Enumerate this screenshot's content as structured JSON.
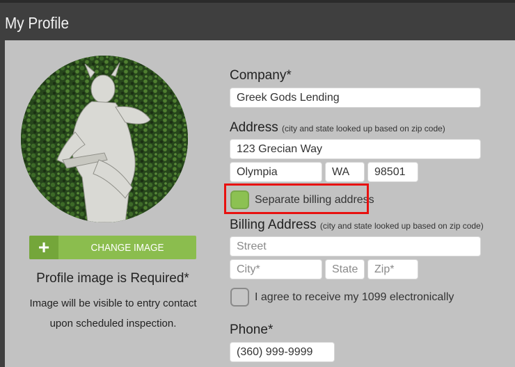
{
  "header": {
    "title": "My Profile"
  },
  "profile_image": {
    "change_button_label": "CHANGE IMAGE",
    "required_text": "Profile image is Required*",
    "visibility_note": "Image will be visible to entry contact upon scheduled inspection."
  },
  "company": {
    "label": "Company*",
    "value": "Greek Gods Lending"
  },
  "address": {
    "label": "Address",
    "hint": "(city and state looked up based on zip code)",
    "street": "123 Grecian Way",
    "city": "Olympia",
    "state": "WA",
    "zip": "98501"
  },
  "separate_billing": {
    "label": "Separate billing address",
    "checked": true
  },
  "billing_address": {
    "label": "Billing Address",
    "hint": "(city and state looked up based on zip code)",
    "street_placeholder": "Street",
    "city_placeholder": "City*",
    "state_placeholder": "State",
    "zip_placeholder": "Zip*"
  },
  "agree_1099": {
    "label": "I agree to receive my 1099 electronically",
    "checked": false
  },
  "phone": {
    "label": "Phone*",
    "value": "(360) 999-9999"
  },
  "colors": {
    "accent": "#8bbd4e",
    "highlight": "#e8110f",
    "header": "#3f3f3f"
  }
}
